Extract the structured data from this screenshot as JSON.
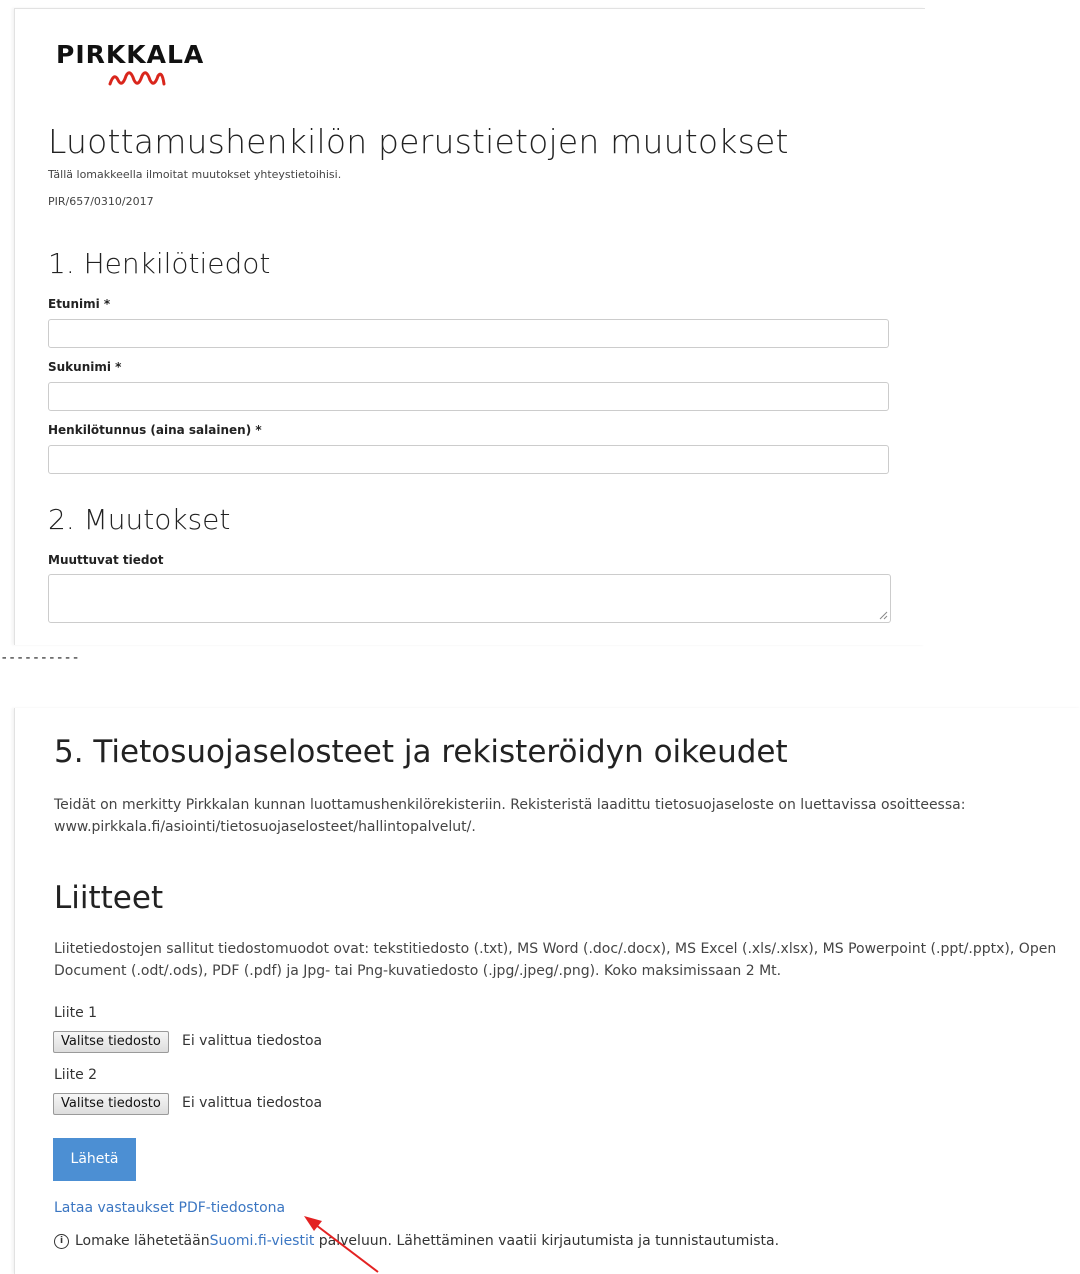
{
  "logo": {
    "text": "PIRKKALA",
    "wave_color": "#d9261c"
  },
  "form": {
    "title": "Luottamushenkilön perustietojen muutokset",
    "description": "Tällä lomakkeella ilmoitat muutokset yhteystietoihisi.",
    "reference": "PIR/657/0310/2017"
  },
  "section1": {
    "heading": "1. Henkilötiedot",
    "fields": [
      {
        "label": "Etunimi *",
        "value": ""
      },
      {
        "label": "Sukunimi *",
        "value": ""
      },
      {
        "label": "Henkilötunnus (aina salainen) *",
        "value": ""
      }
    ]
  },
  "section2": {
    "heading": "2. Muutokset",
    "field_label": "Muuttuvat tiedot",
    "value": ""
  },
  "separator": "----------",
  "section5": {
    "heading": "5. Tietosuojaselosteet ja rekisteröidyn oikeudet",
    "text": "Teidät on merkitty Pirkkalan kunnan luottamushenkilörekisteriin. Rekisteristä laadittu tietosuojaseloste on luettavissa osoitteessa: www.pirkkala.fi/asiointi/tietosuojaselosteet/hallintopalvelut/."
  },
  "attachments": {
    "heading": "Liitteet",
    "text": "Liitetiedostojen sallitut tiedostomuodot ovat: tekstitiedosto (.txt), MS Word (.doc/.docx), MS Excel (.xls/.xlsx), MS Powerpoint (.ppt/.pptx), Open Document (.odt/.ods), PDF (.pdf) ja Jpg- tai Png-kuvatiedosto (.jpg/.jpeg/.png). Koko maksimissaan 2 Mt.",
    "items": [
      {
        "label": "Liite 1",
        "button": "Valitse tiedosto",
        "status": "Ei valittua tiedostoa"
      },
      {
        "label": "Liite 2",
        "button": "Valitse tiedosto",
        "status": "Ei valittua tiedostoa"
      }
    ]
  },
  "submit": {
    "label": "Lähetä",
    "color": "#4c8fd3"
  },
  "download_link": "Lataa vastaukset PDF-tiedostona",
  "footer": {
    "info_prefix": "Lomake lähetetään ",
    "service_link": "Suomi.fi-viestit",
    "info_suffix": " palveluun. Lähettäminen vaatii kirjautumista ja tunnistautumista."
  },
  "annotation": {
    "arrow_color": "#e32222"
  }
}
